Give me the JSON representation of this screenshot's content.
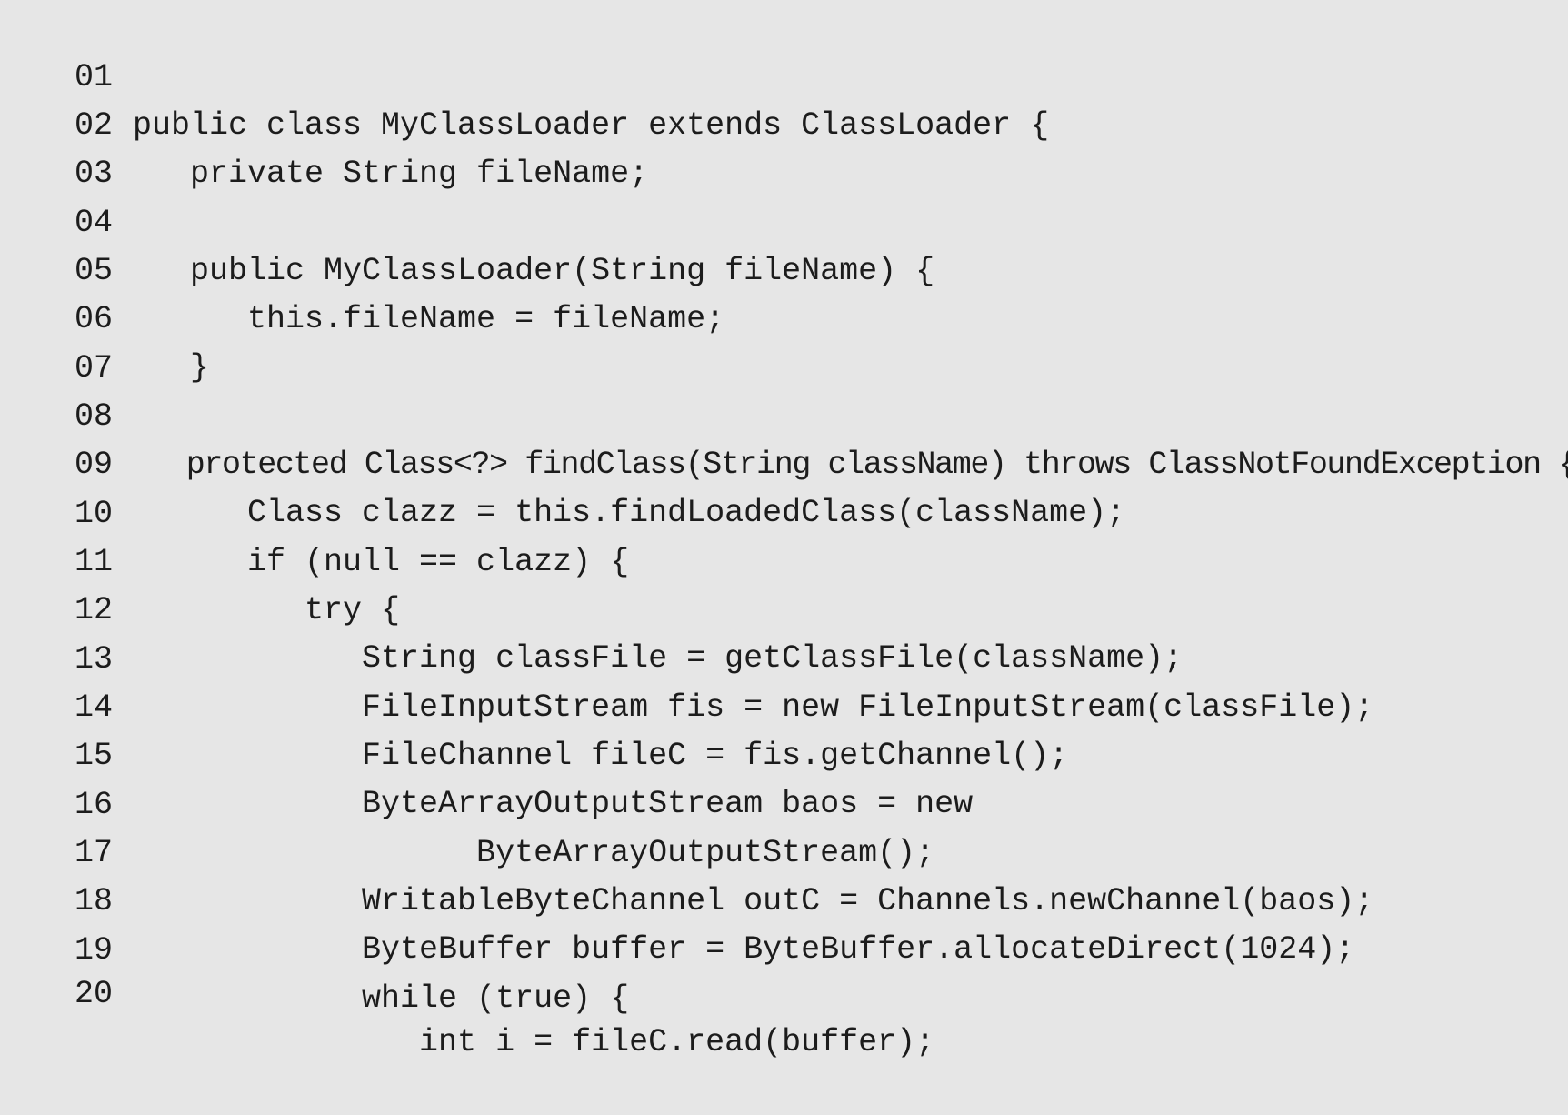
{
  "code_listing": {
    "lines": [
      {
        "number": "01",
        "code": "public class MyClassLoader extends ClassLoader {"
      },
      {
        "number": "02",
        "code": "   private String fileName;"
      },
      {
        "number": "03",
        "code": ""
      },
      {
        "number": "04",
        "code": "   public MyClassLoader(String fileName) {"
      },
      {
        "number": "05",
        "code": "      this.fileName = fileName;"
      },
      {
        "number": "06",
        "code": "   }"
      },
      {
        "number": "07",
        "code": ""
      },
      {
        "number": "08",
        "code": "   protected Class<?> findClass(String className) throws ClassNotFoundException {"
      },
      {
        "number": "09",
        "code": "      Class clazz = this.findLoadedClass(className);"
      },
      {
        "number": "10",
        "code": "      if (null == clazz) {"
      },
      {
        "number": "11",
        "code": "         try {"
      },
      {
        "number": "12",
        "code": "            String classFile = getClassFile(className);"
      },
      {
        "number": "13",
        "code": "            FileInputStream fis = new FileInputStream(classFile);"
      },
      {
        "number": "14",
        "code": "            FileChannel fileC = fis.getChannel();"
      },
      {
        "number": "15",
        "code": "            ByteArrayOutputStream baos = new"
      },
      {
        "number": "16",
        "code": "                  ByteArrayOutputStream();"
      },
      {
        "number": "17",
        "code": "            WritableByteChannel outC = Channels.newChannel(baos);"
      },
      {
        "number": "18",
        "code": "            ByteBuffer buffer = ByteBuffer.allocateDirect(1024);"
      },
      {
        "number": "19",
        "code": "            while (true) {"
      },
      {
        "number": "20",
        "code": "               int i = fileC.read(buffer);"
      }
    ]
  }
}
